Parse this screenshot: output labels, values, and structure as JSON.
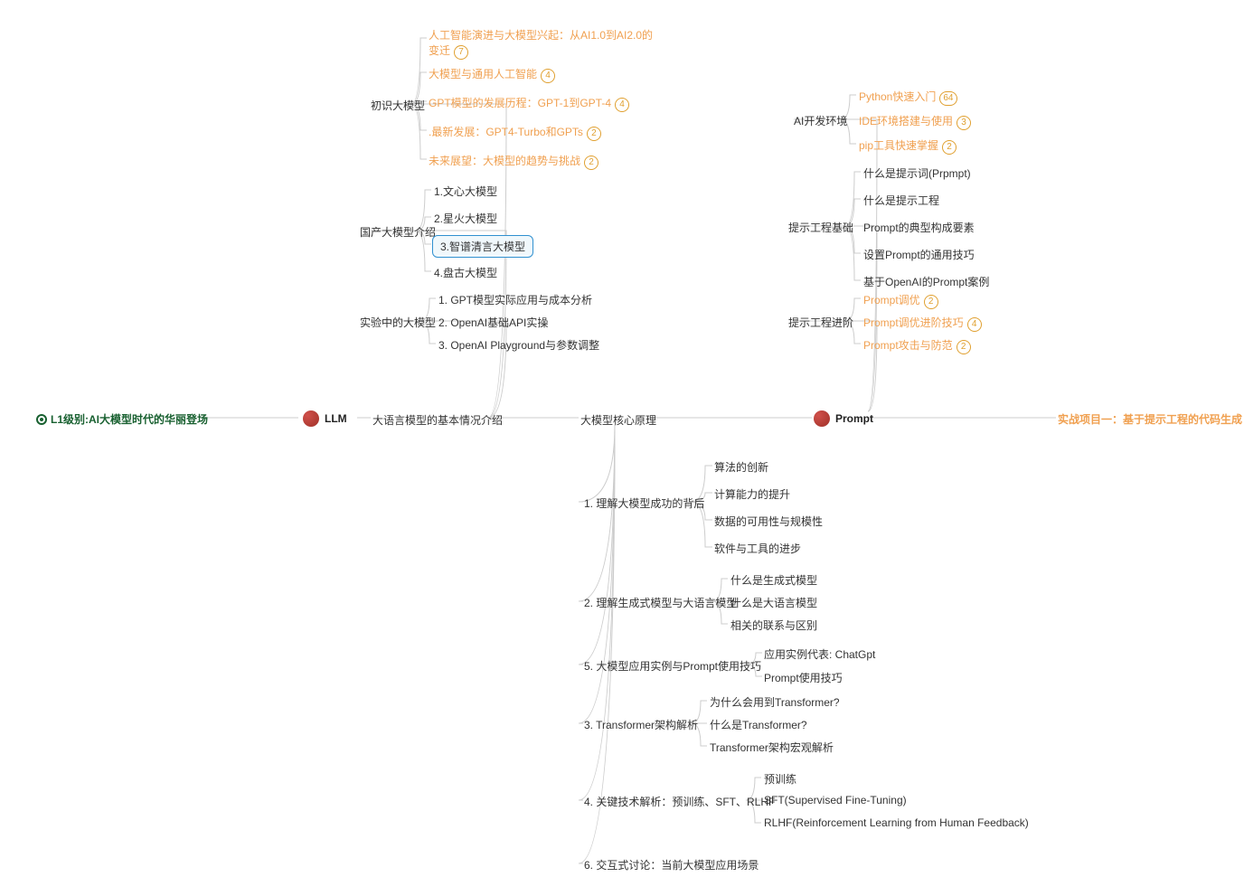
{
  "root": {
    "label": "L1级别:AI大模型时代的华丽登场"
  },
  "llm": {
    "label": "LLM",
    "subtitle": "大语言模型的基本情况介绍"
  },
  "prompt": {
    "label": "Prompt"
  },
  "project": {
    "label": "实战项目一：基于提示工程的代码生成"
  },
  "core": {
    "label": "大模型核心原理"
  },
  "br1": {
    "label": "初识大模型",
    "children": [
      {
        "label": "人工智能演进与大模型兴起：从AI1.0到AI2.0的变迁",
        "badge": "7"
      },
      {
        "label": "大模型与通用人工智能",
        "badge": "4"
      },
      {
        "label": "GPT模型的发展历程：GPT-1到GPT-4",
        "badge": "4"
      },
      {
        "label": ".最新发展：GPT4-Turbo和GPTs",
        "badge": "2"
      },
      {
        "label": "未来展望：大模型的趋势与挑战",
        "badge": "2"
      }
    ]
  },
  "br2": {
    "label": "国产大模型介绍",
    "children": [
      {
        "label": "1.文心大模型"
      },
      {
        "label": "2.星火大模型"
      },
      {
        "label": "3.智谱清言大模型",
        "selected": true
      },
      {
        "label": "4.盘古大模型"
      }
    ]
  },
  "br3": {
    "label": "实验中的大模型",
    "children": [
      {
        "label": "1. GPT模型实际应用与成本分析"
      },
      {
        "label": "2. OpenAI基础API实操"
      },
      {
        "label": "3. OpenAI Playground与参数调整"
      }
    ]
  },
  "core_children": [
    {
      "label": "1. 理解大模型成功的背后",
      "children": [
        "算法的创新",
        "计算能力的提升",
        "数据的可用性与规模性",
        "软件与工具的进步"
      ]
    },
    {
      "label": "2. 理解生成式模型与大语言模型",
      "children": [
        "什么是生成式模型",
        "什么是大语言模型",
        "相关的联系与区别"
      ]
    },
    {
      "label": "5. 大模型应用实例与Prompt使用技巧",
      "children": [
        "应用实例代表: ChatGpt",
        "Prompt使用技巧"
      ]
    },
    {
      "label": "3. Transformer架构解析",
      "children": [
        "为什么会用到Transformer?",
        "什么是Transformer?",
        "Transformer架构宏观解析"
      ]
    },
    {
      "label": "4. 关键技术解析：预训练、SFT、RLHF",
      "children": [
        "预训练",
        "SFT(Supervised Fine-Tuning)",
        "RLHF(Reinforcement Learning from Human Feedback)"
      ]
    },
    {
      "label": "6. 交互式讨论：当前大模型应用场景"
    }
  ],
  "prompt_branches": [
    {
      "label": "AI开发环境",
      "children": [
        {
          "label": "Python快速入门",
          "badge": "64"
        },
        {
          "label": "IDE环境搭建与使用",
          "badge": "3"
        },
        {
          "label": "pip工具快速掌握",
          "badge": "2"
        }
      ]
    },
    {
      "label": "提示工程基础",
      "children": [
        {
          "label": "什么是提示词(Prpmpt)"
        },
        {
          "label": "什么是提示工程"
        },
        {
          "label": "Prompt的典型构成要素"
        },
        {
          "label": "设置Prompt的通用技巧"
        },
        {
          "label": "基于OpenAI的Prompt案例"
        }
      ]
    },
    {
      "label": "提示工程进阶",
      "children": [
        {
          "label": "Prompt调优",
          "badge": "2"
        },
        {
          "label": "Prompt调优进阶技巧",
          "badge": "4"
        },
        {
          "label": "Prompt攻击与防范",
          "badge": "2"
        }
      ]
    }
  ]
}
